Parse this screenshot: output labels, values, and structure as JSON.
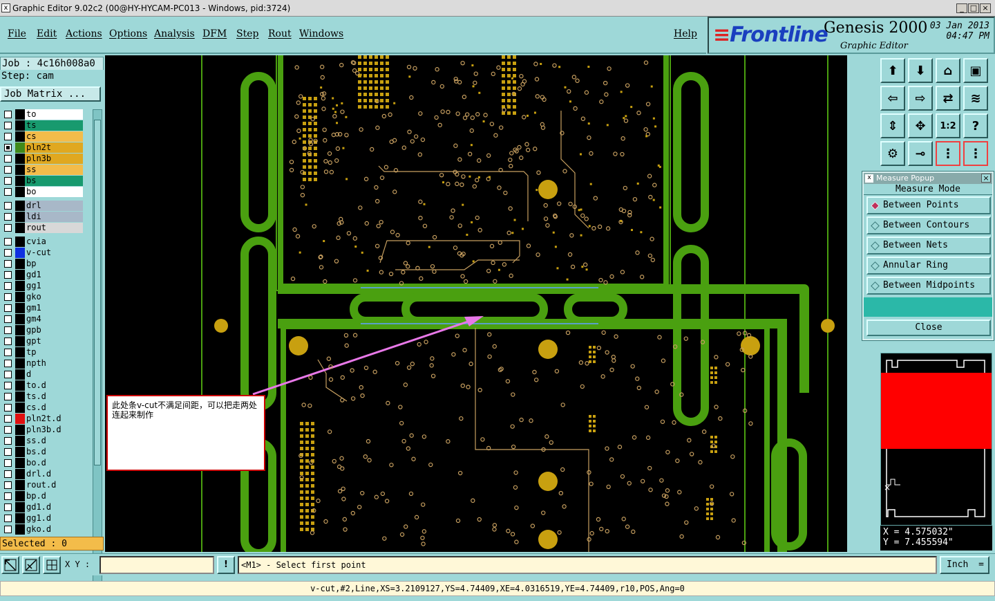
{
  "window": {
    "title": "Graphic Editor 9.02c2 (00@HY-HYCAM-PC013 - Windows, pid:3724)",
    "icon": "editor-icon"
  },
  "menu": [
    "File",
    "Edit",
    "Actions",
    "Options",
    "Analysis",
    "DFM",
    "Step",
    "Rout",
    "Windows"
  ],
  "help": "Help",
  "brand": {
    "logo": "Frontline",
    "product": "Genesis 2000",
    "subtitle": "Graphic Editor",
    "date": "03 Jan 2013",
    "time": "04:47 PM"
  },
  "job": {
    "job_label": "Job : 4c16h008a0",
    "step_label": "Step: cam",
    "matrix_button": "Job Matrix ..."
  },
  "layers": [
    {
      "name": "to",
      "color": "#ffffff",
      "swatch": "#000000",
      "checked": false
    },
    {
      "name": "ts",
      "color": "#189a6e",
      "swatch": "#000000",
      "checked": false
    },
    {
      "name": "cs",
      "color": "#f3bc4a",
      "swatch": "#000000",
      "checked": false
    },
    {
      "name": "pln2t",
      "color": "#e0a820",
      "swatch": "#3f8a1a",
      "checked": true
    },
    {
      "name": "pln3b",
      "color": "#e0a820",
      "swatch": "#000000",
      "checked": false
    },
    {
      "name": "ss",
      "color": "#f3bc4a",
      "swatch": "#000000",
      "checked": false
    },
    {
      "name": "bs",
      "color": "#189a6e",
      "swatch": "#000000",
      "checked": false
    },
    {
      "name": "bo",
      "color": "#ffffff",
      "swatch": "#000000",
      "checked": false
    },
    {
      "name": "drl",
      "color": "#a8b8c8",
      "swatch": "#000000",
      "checked": false,
      "gap": true
    },
    {
      "name": "ldi",
      "color": "#a8b8c8",
      "swatch": "#000000",
      "checked": false
    },
    {
      "name": "rout",
      "color": "#d8d8d8",
      "swatch": "#000000",
      "checked": false
    },
    {
      "name": "cvia",
      "color": "#9ed8d8",
      "swatch": "#000000",
      "checked": false,
      "gap": true
    },
    {
      "name": "v-cut",
      "color": "#9ed8d8",
      "swatch": "#1030e0",
      "checked": false
    },
    {
      "name": "bp",
      "color": "#9ed8d8",
      "swatch": "#000000",
      "checked": false
    },
    {
      "name": "gd1",
      "color": "#9ed8d8",
      "swatch": "#000000",
      "checked": false
    },
    {
      "name": "gg1",
      "color": "#9ed8d8",
      "swatch": "#000000",
      "checked": false
    },
    {
      "name": "gko",
      "color": "#9ed8d8",
      "swatch": "#000000",
      "checked": false
    },
    {
      "name": "gm1",
      "color": "#9ed8d8",
      "swatch": "#000000",
      "checked": false
    },
    {
      "name": "gm4",
      "color": "#9ed8d8",
      "swatch": "#000000",
      "checked": false
    },
    {
      "name": "gpb",
      "color": "#9ed8d8",
      "swatch": "#000000",
      "checked": false
    },
    {
      "name": "gpt",
      "color": "#9ed8d8",
      "swatch": "#000000",
      "checked": false
    },
    {
      "name": "tp",
      "color": "#9ed8d8",
      "swatch": "#000000",
      "checked": false
    },
    {
      "name": "npth",
      "color": "#9ed8d8",
      "swatch": "#000000",
      "checked": false
    },
    {
      "name": "d",
      "color": "#9ed8d8",
      "swatch": "#000000",
      "checked": false
    },
    {
      "name": "to.d",
      "color": "#9ed8d8",
      "swatch": "#000000",
      "checked": false
    },
    {
      "name": "ts.d",
      "color": "#9ed8d8",
      "swatch": "#000000",
      "checked": false
    },
    {
      "name": "cs.d",
      "color": "#9ed8d8",
      "swatch": "#000000",
      "checked": false
    },
    {
      "name": "pln2t.d",
      "color": "#9ed8d8",
      "swatch": "#e01010",
      "checked": false
    },
    {
      "name": "pln3b.d",
      "color": "#9ed8d8",
      "swatch": "#000000",
      "checked": false
    },
    {
      "name": "ss.d",
      "color": "#9ed8d8",
      "swatch": "#000000",
      "checked": false
    },
    {
      "name": "bs.d",
      "color": "#9ed8d8",
      "swatch": "#000000",
      "checked": false
    },
    {
      "name": "bo.d",
      "color": "#9ed8d8",
      "swatch": "#000000",
      "checked": false
    },
    {
      "name": "drl.d",
      "color": "#9ed8d8",
      "swatch": "#000000",
      "checked": false
    },
    {
      "name": "rout.d",
      "color": "#9ed8d8",
      "swatch": "#000000",
      "checked": false
    },
    {
      "name": "bp.d",
      "color": "#9ed8d8",
      "swatch": "#000000",
      "checked": false
    },
    {
      "name": "gd1.d",
      "color": "#9ed8d8",
      "swatch": "#000000",
      "checked": false
    },
    {
      "name": "gg1.d",
      "color": "#9ed8d8",
      "swatch": "#000000",
      "checked": false
    },
    {
      "name": "gko.d",
      "color": "#9ed8d8",
      "swatch": "#000000",
      "checked": false
    }
  ],
  "selected": "Selected : 0",
  "measure": {
    "title": "Measure Popup",
    "mode": "Measure Mode",
    "options": [
      "Between Points",
      "Between Contours",
      "Between Nets",
      "Annular Ring",
      "Between Midpoints"
    ],
    "selected_index": 0,
    "close": "Close"
  },
  "coords": {
    "x": "X = 4.575032\"",
    "y": "Y = 7.455594\""
  },
  "bottom": {
    "xy_label": "X Y :",
    "xy_value": "",
    "prompt": "<M1> - Select first point",
    "unit": "Inch",
    "bang": "!"
  },
  "feature": "v-cut,#2,Line,XS=3.2109127,YS=4.74409,XE=4.0316519,YE=4.74409,r10,POS,Ang=0",
  "annotation": "此处条v-cut不满足间距，可以把走两处连起来制作",
  "colors": {
    "board": "#4aa010",
    "pad": "#c8a010",
    "trace": "#c8a060",
    "vcut": "#5aa0c8",
    "arrow": "#e878e8"
  }
}
